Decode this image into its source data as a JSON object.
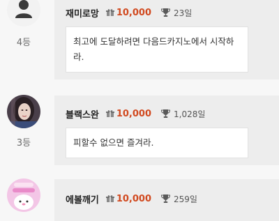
{
  "posts": [
    {
      "nickname": "재미로망",
      "points": "10,000",
      "days": "23일",
      "rank": "4등",
      "message": "최고에 도달하려면 다음드카지노에서 시작하라.",
      "avatar": "default-user-icon"
    },
    {
      "nickname": "블랙스완",
      "points": "10,000",
      "days": "1,028일",
      "rank": "3등",
      "message": "피할수 없으면 즐겨라.",
      "avatar": "woman-photo-avatar"
    },
    {
      "nickname": "에볼깨기",
      "points": "10,000",
      "days": "259일",
      "rank": "",
      "message": "",
      "avatar": "pink-cartoon-avatar"
    }
  ],
  "colors": {
    "points": "#d1491f",
    "card_bg": "#ededed",
    "page_bg": "#f7f7f7"
  }
}
